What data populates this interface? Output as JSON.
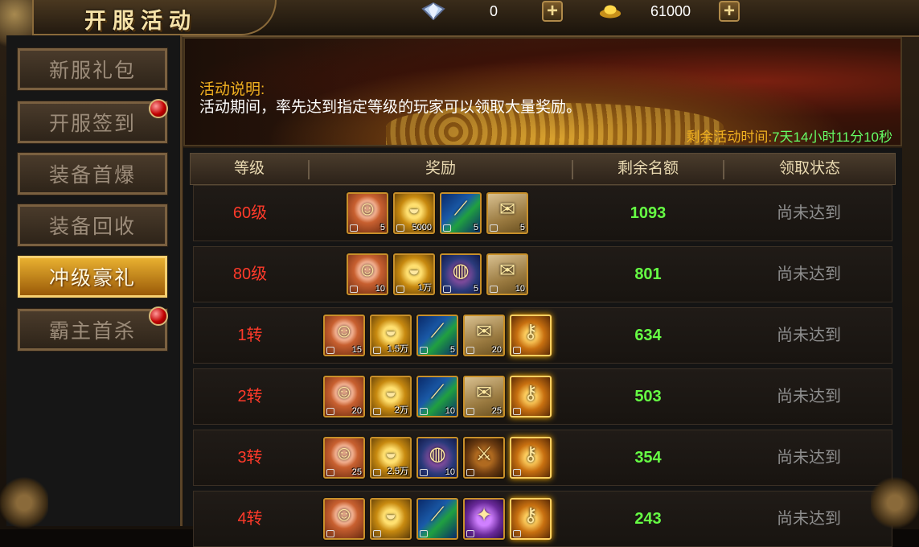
{
  "header": {
    "title": "开服活动",
    "diamonds": "0",
    "gold": "61000"
  },
  "sidebar": {
    "items": [
      {
        "label": "新服礼包",
        "active": false,
        "badge": false
      },
      {
        "label": "开服签到",
        "active": false,
        "badge": true
      },
      {
        "label": "装备首爆",
        "active": false,
        "badge": false
      },
      {
        "label": "装备回收",
        "active": false,
        "badge": false
      },
      {
        "label": "冲级豪礼",
        "active": true,
        "badge": false
      },
      {
        "label": "霸主首杀",
        "active": false,
        "badge": true
      }
    ]
  },
  "banner": {
    "title": "活动说明:",
    "description": "活动期间，率先达到指定等级的玩家可以领取大量奖励。",
    "timer_label": "剩余活动时间:",
    "timer_value": "7天14小时11分10秒"
  },
  "table": {
    "headers": [
      "等级",
      "奖励",
      "剩余名额",
      "领取状态"
    ],
    "rows": [
      {
        "level": "60级",
        "count": "1093",
        "status": "尚未达到",
        "rewards": [
          {
            "icon": "portrait-icon",
            "qty": "5"
          },
          {
            "icon": "gold-ingot-icon",
            "qty": "5000"
          },
          {
            "icon": "green-scroll-icon",
            "qty": "5"
          },
          {
            "icon": "map-scroll-icon",
            "qty": "5"
          }
        ]
      },
      {
        "level": "80级",
        "count": "801",
        "status": "尚未达到",
        "rewards": [
          {
            "icon": "portrait-icon",
            "qty": "10"
          },
          {
            "icon": "gold-ingot-icon",
            "qty": "1万"
          },
          {
            "icon": "bag-icon",
            "qty": "5"
          },
          {
            "icon": "map-scroll-icon",
            "qty": "10"
          }
        ]
      },
      {
        "level": "1转",
        "count": "634",
        "status": "尚未达到",
        "rewards": [
          {
            "icon": "portrait-icon",
            "qty": "15"
          },
          {
            "icon": "gold-ingot-icon",
            "qty": "1.5万"
          },
          {
            "icon": "green-scroll-icon",
            "qty": "5"
          },
          {
            "icon": "map-scroll-icon",
            "qty": "20"
          },
          {
            "icon": "golden-key-icon",
            "qty": ""
          }
        ]
      },
      {
        "level": "2转",
        "count": "503",
        "status": "尚未达到",
        "rewards": [
          {
            "icon": "portrait-icon",
            "qty": "20"
          },
          {
            "icon": "gold-ingot-icon",
            "qty": "2万"
          },
          {
            "icon": "green-scroll-icon",
            "qty": "10"
          },
          {
            "icon": "map-scroll-icon",
            "qty": "25"
          },
          {
            "icon": "golden-key-icon",
            "qty": ""
          }
        ]
      },
      {
        "level": "3转",
        "count": "354",
        "status": "尚未达到",
        "rewards": [
          {
            "icon": "portrait-icon",
            "qty": "25"
          },
          {
            "icon": "gold-ingot-icon",
            "qty": "2.5万"
          },
          {
            "icon": "bag-icon",
            "qty": "10"
          },
          {
            "icon": "sword-bag-icon",
            "qty": ""
          },
          {
            "icon": "golden-key-icon",
            "qty": ""
          }
        ]
      },
      {
        "level": "4转",
        "count": "243",
        "status": "尚未达到",
        "rewards": [
          {
            "icon": "portrait-icon",
            "qty": ""
          },
          {
            "icon": "gold-ingot-icon",
            "qty": ""
          },
          {
            "icon": "green-scroll-icon",
            "qty": ""
          },
          {
            "icon": "purple-orb-icon",
            "qty": ""
          },
          {
            "icon": "golden-key-icon",
            "qty": ""
          }
        ]
      }
    ]
  }
}
